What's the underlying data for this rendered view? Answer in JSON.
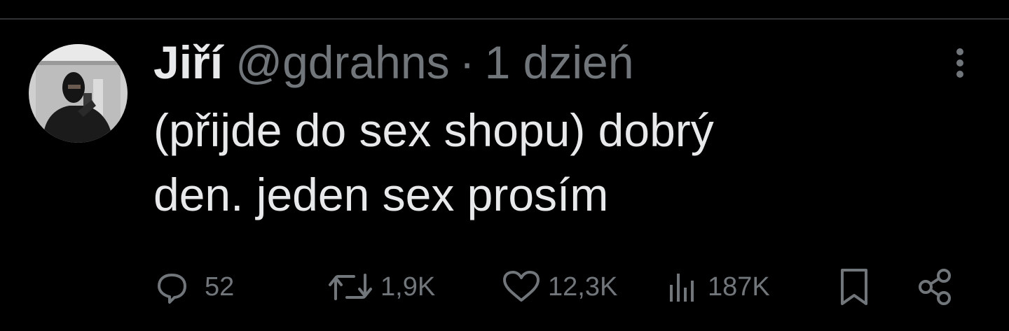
{
  "tweet": {
    "author_name": "Jiří",
    "author_handle": "@gdrahns",
    "separator": "·",
    "timestamp": "1 dzień",
    "text": "(přijde do sex shopu) dobrý\nden. jeden sex prosím"
  },
  "actions": {
    "replies": "52",
    "retweets": "1,9K",
    "likes": "12,3K",
    "views": "187K"
  },
  "icons": {
    "reply": "reply-icon",
    "retweet": "retweet-icon",
    "like": "heart-icon",
    "views": "views-icon",
    "bookmark": "bookmark-icon",
    "share": "share-icon",
    "more": "more-icon"
  },
  "colors": {
    "background": "#000000",
    "primary_text": "#e7e9ea",
    "secondary_text": "#71767b",
    "divider": "#2f3336"
  }
}
